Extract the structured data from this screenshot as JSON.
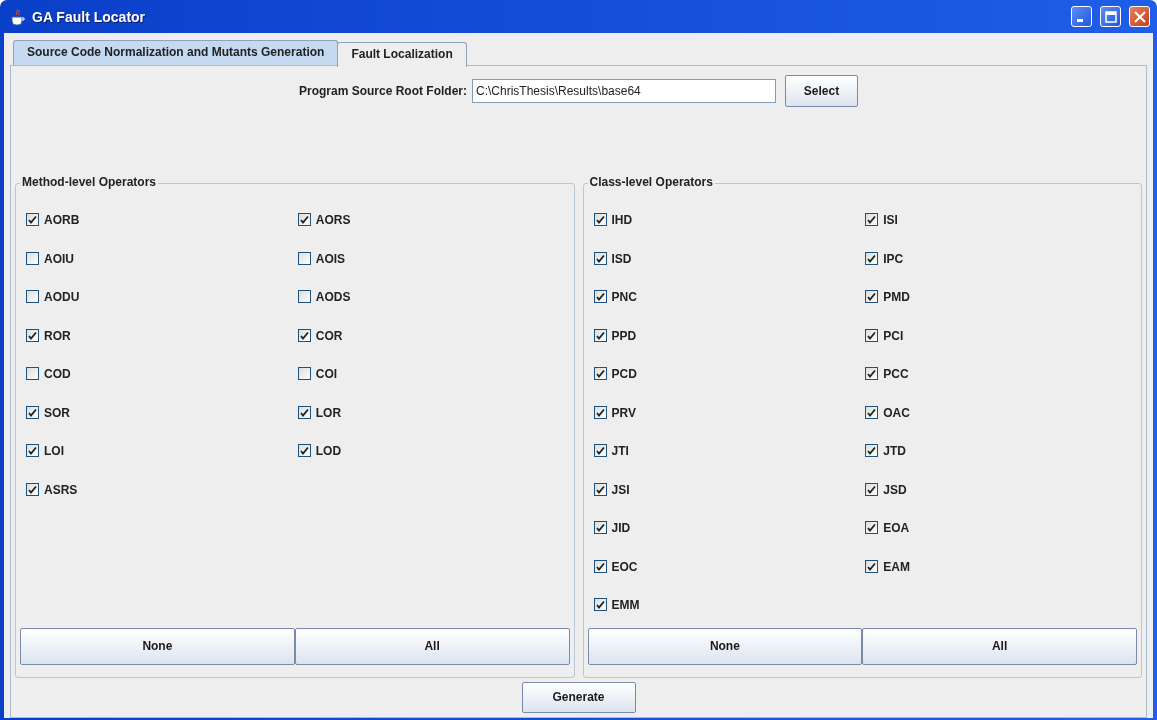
{
  "window": {
    "title": "GA Fault Locator"
  },
  "tabs": [
    {
      "label": "Source Code Normalization and Mutants Generation",
      "selected": true
    },
    {
      "label": "Fault Localization",
      "selected": false
    }
  ],
  "source_folder": {
    "label": "Program Source Root Folder:",
    "value": "C:\\ChrisThesis\\Results\\base64",
    "button": "Select"
  },
  "groups": [
    {
      "title": "Method-level Operators",
      "operators": [
        {
          "label": "AORB",
          "checked": true
        },
        {
          "label": "AORS",
          "checked": true
        },
        {
          "label": "AOIU",
          "checked": false
        },
        {
          "label": "AOIS",
          "checked": false
        },
        {
          "label": "AODU",
          "checked": false
        },
        {
          "label": "AODS",
          "checked": false
        },
        {
          "label": "ROR",
          "checked": true
        },
        {
          "label": "COR",
          "checked": true
        },
        {
          "label": "COD",
          "checked": false
        },
        {
          "label": "COI",
          "checked": false
        },
        {
          "label": "SOR",
          "checked": true
        },
        {
          "label": "LOR",
          "checked": true
        },
        {
          "label": "LOI",
          "checked": true
        },
        {
          "label": "LOD",
          "checked": true
        },
        {
          "label": "ASRS",
          "checked": true
        }
      ],
      "buttons": [
        "None",
        "All"
      ]
    },
    {
      "title": "Class-level Operators",
      "operators": [
        {
          "label": "IHD",
          "checked": true
        },
        {
          "label": "ISI",
          "checked": true
        },
        {
          "label": "ISD",
          "checked": true
        },
        {
          "label": "IPC",
          "checked": true
        },
        {
          "label": "PNC",
          "checked": true
        },
        {
          "label": "PMD",
          "checked": true
        },
        {
          "label": "PPD",
          "checked": true
        },
        {
          "label": "PCI",
          "checked": true
        },
        {
          "label": "PCD",
          "checked": true
        },
        {
          "label": "PCC",
          "checked": true
        },
        {
          "label": "PRV",
          "checked": true
        },
        {
          "label": "OAC",
          "checked": true
        },
        {
          "label": "JTI",
          "checked": true
        },
        {
          "label": "JTD",
          "checked": true
        },
        {
          "label": "JSI",
          "checked": true
        },
        {
          "label": "JSD",
          "checked": true
        },
        {
          "label": "JID",
          "checked": true
        },
        {
          "label": "EOA",
          "checked": true
        },
        {
          "label": "EOC",
          "checked": true
        },
        {
          "label": "EAM",
          "checked": true
        },
        {
          "label": "EMM",
          "checked": true
        }
      ],
      "buttons": [
        "None",
        "All"
      ]
    }
  ],
  "generate_button": "Generate"
}
